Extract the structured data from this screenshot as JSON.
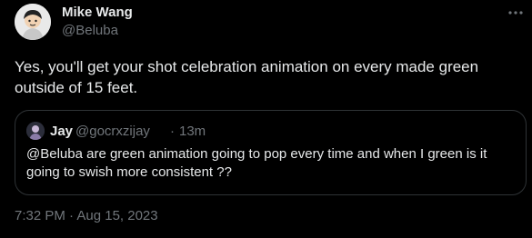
{
  "author": {
    "name": "Mike Wang",
    "handle": "@Beluba",
    "avatar": "cartoon-avatar-icon"
  },
  "tweet": {
    "text": "Yes, you'll get your shot celebration animation on every made green outside of 15 feet.",
    "timestamp": "7:32 PM · Aug 15, 2023"
  },
  "quoted_tweet": {
    "name": "Jay",
    "handle": "@gocrxzijay",
    "separator": "·",
    "time": "13m",
    "text": "@Beluba are green animation going to pop every time and when I green is it going to swish more consistent ??",
    "avatar": "profile-avatar-icon"
  },
  "icons": {
    "more": "more-options-icon"
  },
  "colors": {
    "background": "#000000",
    "primary_text": "#e7e9ea",
    "secondary_text": "#71767b",
    "border": "#2f3336"
  }
}
